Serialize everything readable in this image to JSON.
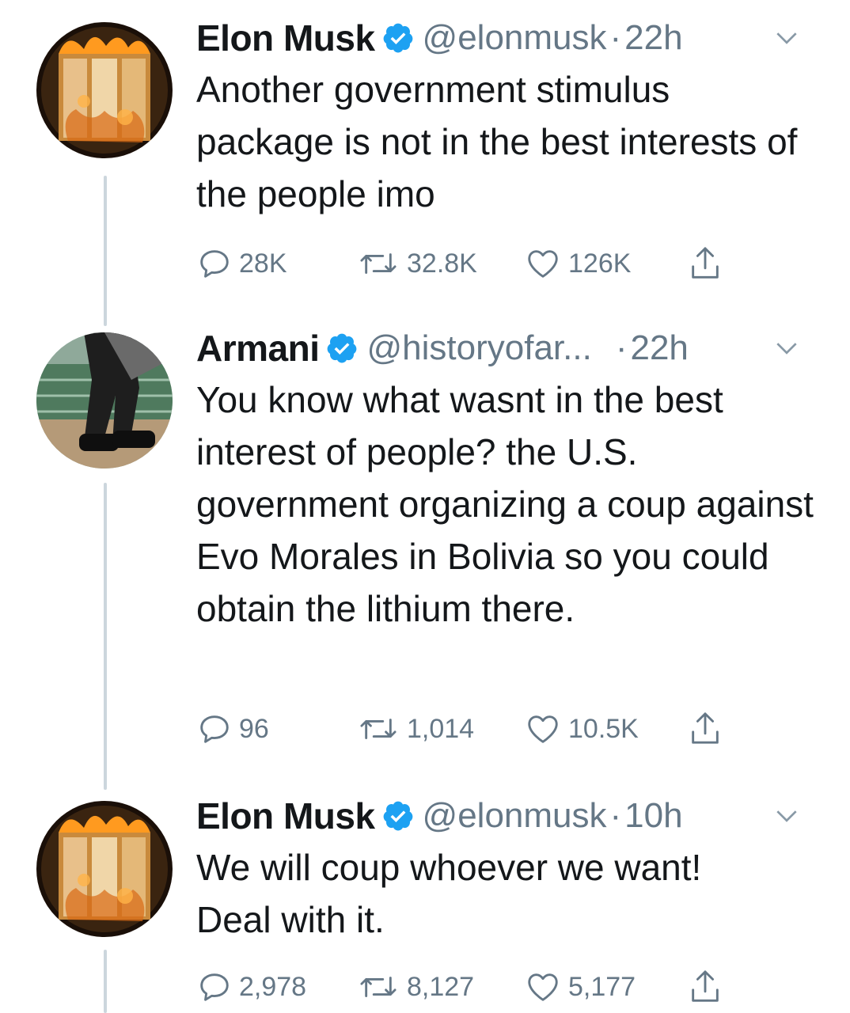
{
  "tweets": [
    {
      "name": "Elon Musk",
      "handle": "@elonmusk",
      "separator": "·",
      "time": "22h",
      "text": "Another government stimulus package is not in the best interests of the people imo",
      "replies": "28K",
      "retweets": "32.8K",
      "likes": "126K"
    },
    {
      "name": "Armani",
      "handle": "@historyofar...",
      "separator": "·",
      "time": "22h",
      "text": "You know what wasnt in the best interest of people? the U.S. government organizing a coup against Evo Morales in Bolivia so you could obtain the lithium there.",
      "replies": "96",
      "retweets": "1,014",
      "likes": "10.5K"
    },
    {
      "name": "Elon Musk",
      "handle": "@elonmusk",
      "separator": "·",
      "time": "10h",
      "text": "We will coup whoever we want! Deal with it.",
      "replies": "2,978",
      "retweets": "8,127",
      "likes": "5,177"
    }
  ],
  "icons": {
    "verified": "verified-badge-icon",
    "menu": "chevron-down-icon",
    "reply": "reply-icon",
    "retweet": "retweet-icon",
    "like": "heart-icon",
    "share": "share-icon"
  },
  "colors": {
    "verified_blue": "#1da1f2",
    "secondary_text": "#657786",
    "thread_line": "#ccd6dd"
  }
}
